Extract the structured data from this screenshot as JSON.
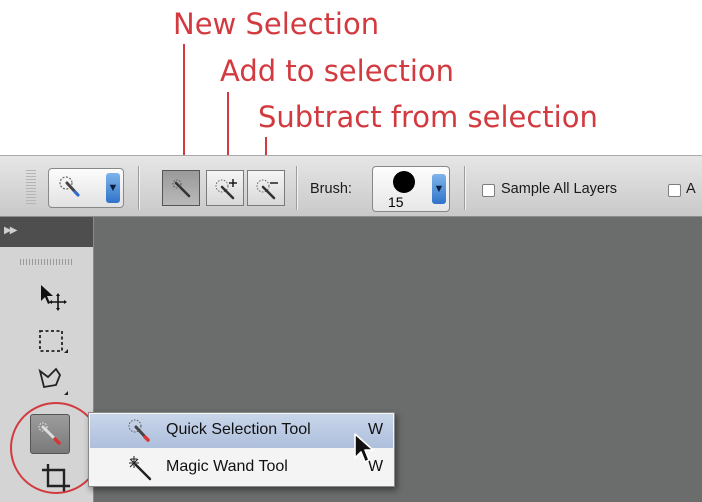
{
  "callouts": {
    "new_selection": "New Selection",
    "add_to_selection": "Add to selection",
    "subtract_from_selection": "Subtract from selection"
  },
  "options_bar": {
    "brush_label": "Brush:",
    "brush_size": "15",
    "sample_all_layers": "Sample All Layers",
    "cut_off_label": "A",
    "selection_mode": "new"
  },
  "flyout": {
    "items": [
      {
        "label": "Quick Selection Tool",
        "shortcut": "W",
        "icon": "quick-selection-icon",
        "selected": true
      },
      {
        "label": "Magic Wand Tool",
        "shortcut": "W",
        "icon": "magic-wand-icon",
        "selected": false
      }
    ]
  },
  "toolbox": {
    "tools": [
      "move-tool-icon",
      "marquee-tool-icon",
      "lasso-tool-icon",
      "quick-selection-icon",
      "crop-tool-icon"
    ],
    "active_tool": "quick-selection-icon"
  },
  "colors": {
    "annotation_red": "#d23a3f",
    "canvas_gray": "#6b6c6c",
    "dropdown_blue": "#2f73c9",
    "menu_highlight": "#b8c7e0"
  }
}
